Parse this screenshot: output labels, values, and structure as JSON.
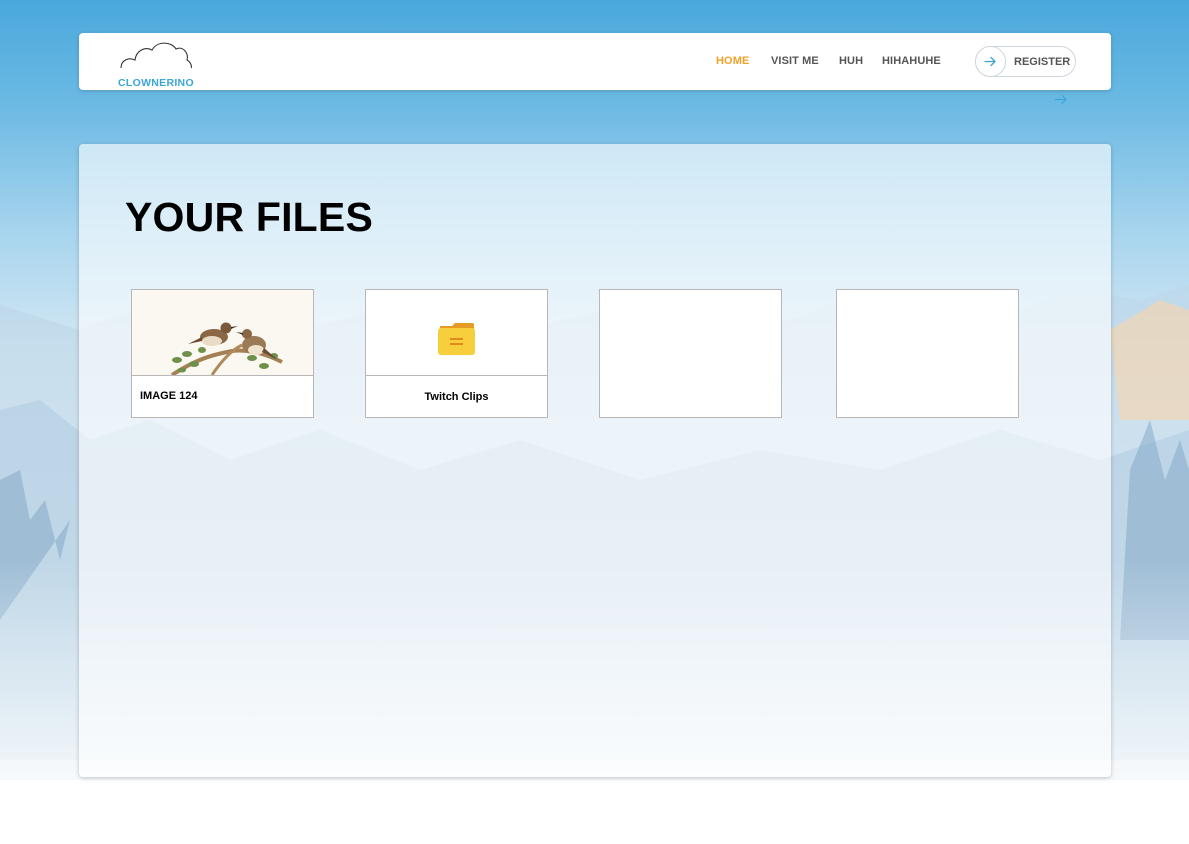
{
  "brand": {
    "name": "CLOWNERINO"
  },
  "nav": {
    "links": [
      {
        "label": "HOME",
        "active": true
      },
      {
        "label": "VISIT ME",
        "active": false
      },
      {
        "label": "HUH",
        "active": false
      },
      {
        "label": "HIHAHUHE",
        "active": false
      }
    ],
    "register_label": "REGISTER"
  },
  "main": {
    "title": "YOUR FILES",
    "files": [
      {
        "name": "IMAGE 124",
        "kind": "image",
        "thumbnail": "birds-illustration"
      },
      {
        "name": "Twitch Clips",
        "kind": "folder",
        "icon": "folder-icon"
      },
      {
        "name": "",
        "kind": "empty"
      },
      {
        "name": "",
        "kind": "empty"
      }
    ]
  },
  "colors": {
    "accent": "#f2a22a",
    "brand": "#3aa6d6",
    "nav_text": "#555555",
    "folder": "#f7cf3c"
  }
}
